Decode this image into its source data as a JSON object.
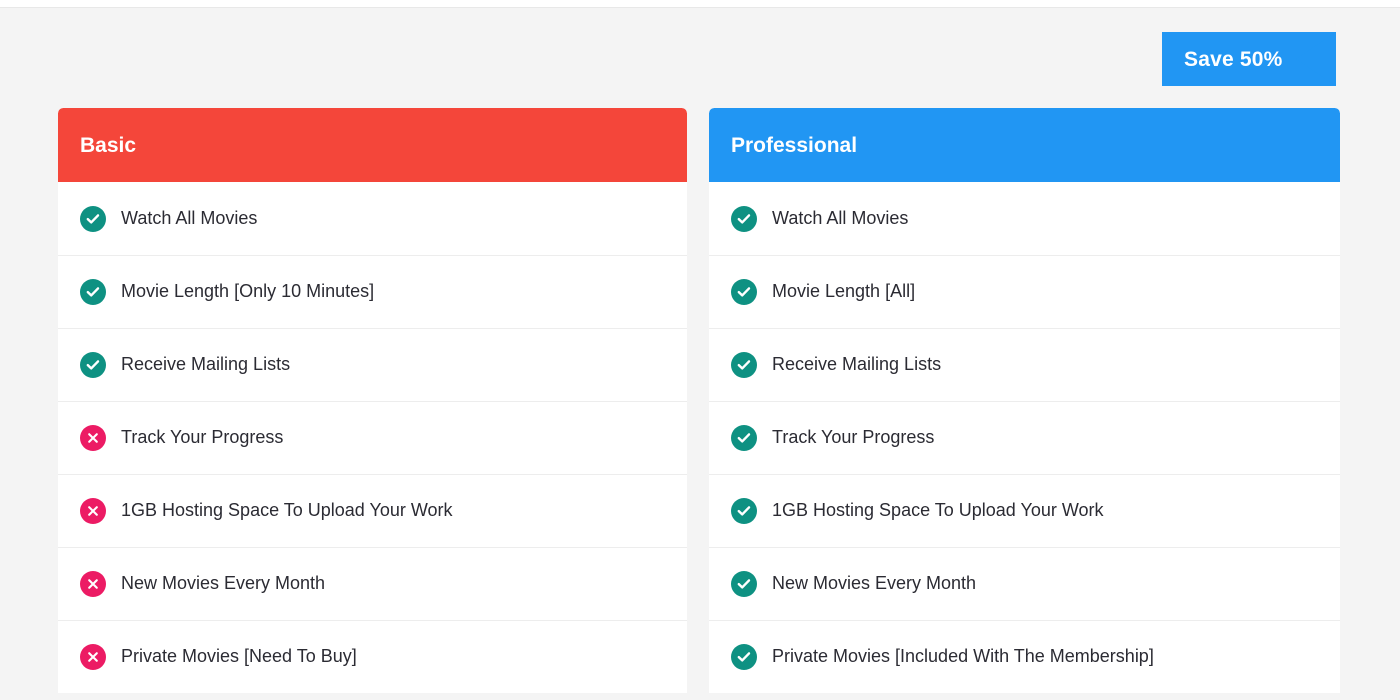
{
  "ribbon": {
    "label": "Save 50%",
    "color": "#2196f3"
  },
  "colors": {
    "page_background": "#f4f4f4",
    "basic_header": "#f4463a",
    "professional_header": "#2196f3",
    "included_icon": "#0e9182",
    "excluded_icon": "#ec1b64",
    "row_divider": "#ededed",
    "text": "#2b2b33"
  },
  "plans": [
    {
      "name": "Basic",
      "header_color": "#f4463a",
      "features": [
        {
          "label": "Watch All Movies",
          "status": "included"
        },
        {
          "label": "Movie Length [Only 10 Minutes]",
          "status": "included"
        },
        {
          "label": "Receive Mailing Lists",
          "status": "included"
        },
        {
          "label": "Track Your Progress",
          "status": "excluded"
        },
        {
          "label": "1GB Hosting Space To Upload Your Work",
          "status": "excluded"
        },
        {
          "label": "New Movies Every Month",
          "status": "excluded"
        },
        {
          "label": "Private Movies [Need To Buy]",
          "status": "excluded"
        }
      ]
    },
    {
      "name": "Professional",
      "header_color": "#2196f3",
      "features": [
        {
          "label": "Watch All Movies",
          "status": "included"
        },
        {
          "label": "Movie Length [All]",
          "status": "included"
        },
        {
          "label": "Receive Mailing Lists",
          "status": "included"
        },
        {
          "label": "Track Your Progress",
          "status": "included"
        },
        {
          "label": "1GB Hosting Space To Upload Your Work",
          "status": "included"
        },
        {
          "label": "New Movies Every Month",
          "status": "included"
        },
        {
          "label": "Private Movies [Included With The Membership]",
          "status": "included"
        }
      ]
    }
  ],
  "icon_names": {
    "included": "check-circle-icon",
    "excluded": "x-circle-icon"
  }
}
